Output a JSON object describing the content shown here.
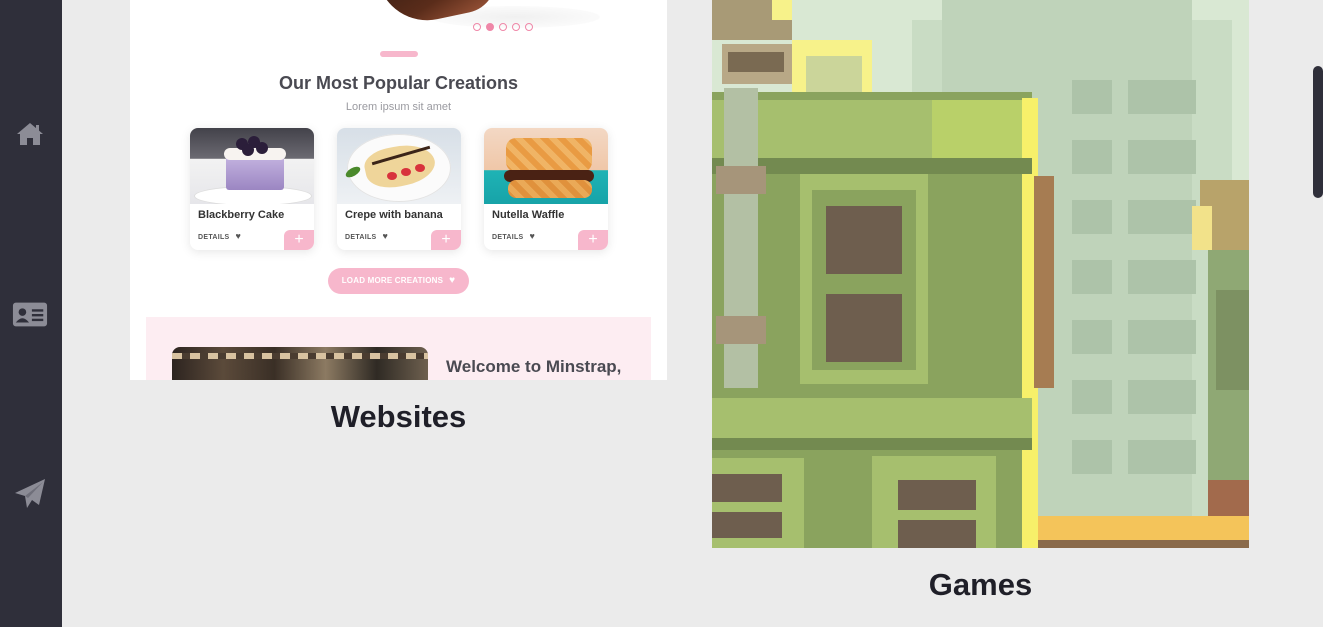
{
  "sidebar": {
    "items": [
      {
        "icon": "home-icon"
      },
      {
        "icon": "contact-card-icon"
      },
      {
        "icon": "paper-plane-icon"
      }
    ]
  },
  "portfolio": {
    "websites_label": "Websites",
    "games_label": "Games"
  },
  "website_preview": {
    "section_title": "Our Most Popular Creations",
    "section_subtitle": "Lorem ipsum sit amet",
    "cards": [
      {
        "name": "Blackberry Cake",
        "details": "DETAILS",
        "action": "+"
      },
      {
        "name": "Crepe with banana",
        "details": "DETAILS",
        "action": "+"
      },
      {
        "name": "Nutella Waffle",
        "details": "DETAILS",
        "action": "+"
      }
    ],
    "load_more": "LOAD MORE CREATIONS",
    "welcome_text": "Welcome to Minstrap,",
    "heart": "♥"
  },
  "colors": {
    "sidebar": "#2f2f3a",
    "background": "#ebebeb",
    "accent_pink": "#f7b7cc"
  }
}
